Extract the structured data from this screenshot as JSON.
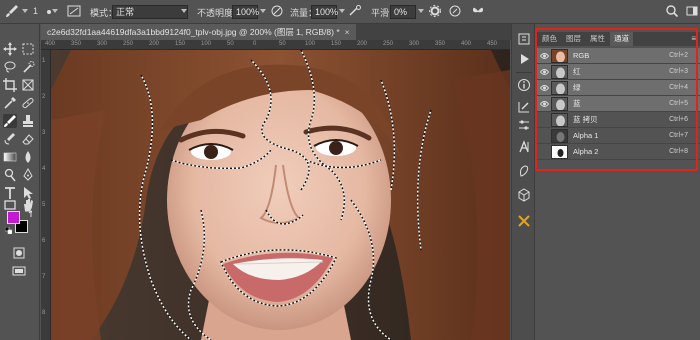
{
  "options_bar": {
    "mode_label": "模式：",
    "mode_value": "正常",
    "opacity_label": "不透明度：",
    "opacity_value": "100%",
    "flow_label": "流量：",
    "flow_value": "100%",
    "smoothing_label": "平滑：",
    "smoothing_value": "0%",
    "brush_size": "1"
  },
  "document": {
    "tab_title": "c2e6d32fd1aa44619dfa3a1bbd9124f0_tplv-obj.jpg @ 200% (图层 1, RGB/8) *",
    "close_glyph": "×",
    "ruler_h": [
      "400",
      "350",
      "300",
      "250",
      "200",
      "150",
      "100",
      "50",
      "0",
      "50",
      "100",
      "150",
      "200",
      "250",
      "300",
      "350",
      "400",
      "450"
    ],
    "ruler_v": [
      "1",
      "2",
      "3",
      "4",
      "5",
      "6",
      "7",
      "8"
    ]
  },
  "colors": {
    "foreground": "#c21ad2",
    "background": "#000000",
    "highlight_border": "#e2231a"
  },
  "panel": {
    "tabs": [
      "颜色",
      "图层",
      "属性",
      "通道"
    ],
    "active_tab": "通道",
    "menu_glyph": "≡",
    "channels": [
      {
        "name": "RGB",
        "shortcut": "Ctrl+2",
        "visible": true,
        "selected": true,
        "thumb": "color"
      },
      {
        "name": "红",
        "shortcut": "Ctrl+3",
        "visible": true,
        "selected": true,
        "thumb": "gray"
      },
      {
        "name": "绿",
        "shortcut": "Ctrl+4",
        "visible": true,
        "selected": true,
        "thumb": "gray"
      },
      {
        "name": "蓝",
        "shortcut": "Ctrl+5",
        "visible": true,
        "selected": true,
        "thumb": "gray"
      },
      {
        "name": "蓝 拷贝",
        "shortcut": "Ctrl+6",
        "visible": false,
        "selected": false,
        "thumb": "gray"
      },
      {
        "name": "Alpha 1",
        "shortcut": "Ctrl+7",
        "visible": false,
        "selected": false,
        "thumb": "dark"
      },
      {
        "name": "Alpha 2",
        "shortcut": "Ctrl+8",
        "visible": false,
        "selected": false,
        "thumb": "white"
      }
    ]
  }
}
